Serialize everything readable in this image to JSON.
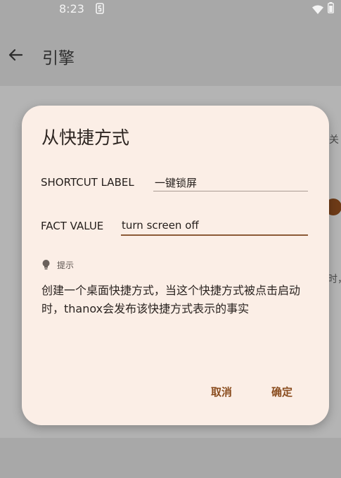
{
  "status_bar": {
    "time": "8:23",
    "notification_icon": "s-icon",
    "wifi_icon": "wifi-icon",
    "battery_icon": "battery-icon"
  },
  "app_bar": {
    "back_icon": "arrow-left-icon",
    "title": "引擎"
  },
  "background": {
    "snippet_1": "关",
    "snippet_2": "时，"
  },
  "dialog": {
    "title": "从快捷方式",
    "shortcut_label": {
      "label": "SHORTCUT LABEL",
      "value": "一键锁屏"
    },
    "fact_value": {
      "label": "FACT VALUE",
      "value": "turn screen off"
    },
    "hint": {
      "icon": "lightbulb-icon",
      "label": "提示",
      "text": "创建一个桌面快捷方式，当这个快捷方式被点击启动时，thanox会发布该快捷方式表示的事实"
    },
    "cancel_label": "取消",
    "confirm_label": "确定"
  },
  "colors": {
    "accent": "#8a4d1f",
    "dialog_background": "#fbeee6",
    "scrim": "#a8a8a8"
  }
}
